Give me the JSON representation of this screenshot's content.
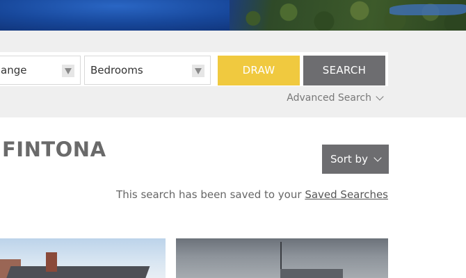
{
  "search": {
    "range_select": {
      "value": "ange"
    },
    "bedrooms_select": {
      "value": "Bedrooms"
    },
    "draw_label": "DRAW",
    "search_label": "SEARCH",
    "advanced_label": "Advanced Search"
  },
  "results": {
    "title": "FINTONA",
    "sort_label": "Sort by",
    "saved_note_prefix": "This search has been saved to your ",
    "saved_note_link": "Saved Searches"
  },
  "colors": {
    "draw_button": "#f0c93f",
    "search_button": "#6d6d70",
    "band_background": "#efefef"
  }
}
